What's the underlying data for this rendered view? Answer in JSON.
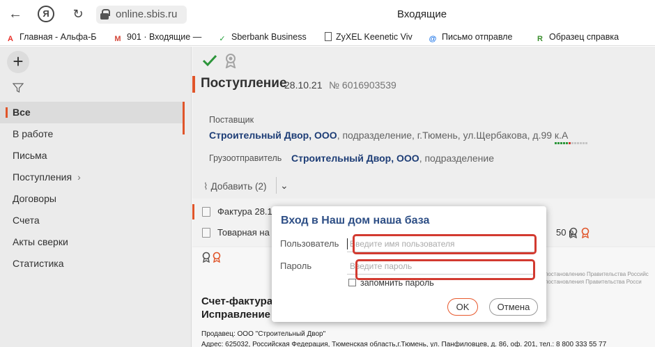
{
  "browser": {
    "url": "online.sbis.ru",
    "title": "Входящие",
    "ya_label": "Я",
    "bookmarks": [
      {
        "label": "Главная - Альфа-Б",
        "icon": "alfa-bank-icon",
        "glyph": "A",
        "color": "#e8302a"
      },
      {
        "label": "901 · Входящие —",
        "icon": "gmail-icon",
        "glyph": "M",
        "color": "#d44638"
      },
      {
        "label": "Sberbank Business",
        "icon": "sberbank-icon",
        "glyph": "✓",
        "color": "#21a038"
      },
      {
        "label": "ZyXEL Keenetic Viv",
        "icon": "page-icon",
        "glyph": "",
        "color": "#555555"
      },
      {
        "label": "Письмо отправле",
        "icon": "mail-at-icon",
        "glyph": "@",
        "color": "#1a73e8"
      },
      {
        "label": "Образец справка",
        "icon": "rub-icon",
        "glyph": "R",
        "color": "#3b8f2e"
      }
    ]
  },
  "sidebar": {
    "plus": "+",
    "items": [
      {
        "label": "Все",
        "active": true
      },
      {
        "label": "В работе"
      },
      {
        "label": "Письма"
      },
      {
        "label": "Поступления",
        "chevron": "›"
      },
      {
        "label": "Договоры"
      },
      {
        "label": "Счета"
      },
      {
        "label": "Акты сверки"
      },
      {
        "label": "Статистика"
      }
    ]
  },
  "document": {
    "title": "Поступление",
    "date": "28.10.21",
    "number": "№ 6016903539",
    "supplier_label": "Поставщик",
    "supplier_name": "Строительный Двор, ООО",
    "supplier_rest": ", подразделение, г.Тюмень, ул.Щербакова, д.99 к.А",
    "shipper_label": "Грузоотправитель",
    "shipper_name": "Строительный Двор, ООО",
    "shipper_rest": ", подразделение",
    "attach_label": "Добавить (2)",
    "files": [
      {
        "name": "Фактура 28.1",
        "price": ""
      },
      {
        "name": "Товарная на",
        "price": "50 р."
      }
    ]
  },
  "preview": {
    "legal_1": "постановлению Правительства Российс",
    "legal_2": "постановления Правительства Росси",
    "title_1": "Счет-фактура",
    "title_2": "Исправление",
    "seller": "Продавец:  ООО \"Строительный Двор\"",
    "address": "Адрес:  625032, Российская Федерация, Тюменская область,г.Тюмень, ул. Панфиловцев, д. 86, оф. 201, тел.: 8 800 333 55 77"
  },
  "dialog": {
    "title": "Вход в Наш дом наша база",
    "user_label": "Пользователь",
    "user_placeholder": "Введите имя пользователя",
    "pass_label": "Пароль",
    "pass_placeholder": "Введите пароль",
    "remember_label": "запомнить пароль",
    "ok_label": "OK",
    "cancel_label": "Отмена"
  },
  "colors": {
    "accent": "#e8582c",
    "link": "#1e3f7a",
    "highlight": "#d23a30",
    "check": "#2e9a3c"
  }
}
